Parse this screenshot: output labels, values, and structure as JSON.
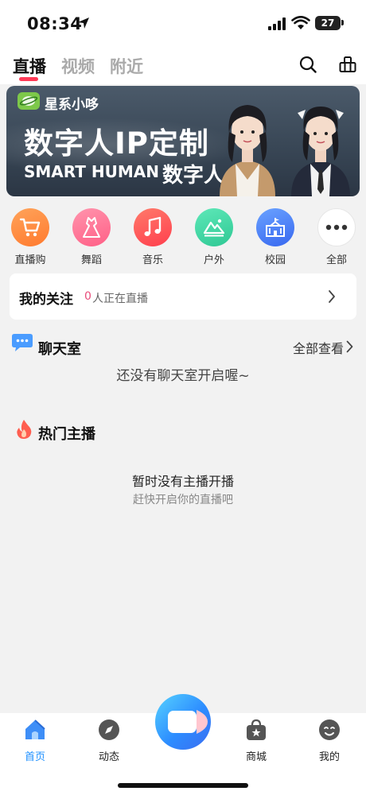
{
  "status_bar": {
    "time": "08:34",
    "battery": "27"
  },
  "top_tabs": [
    {
      "label": "直播",
      "active": true
    },
    {
      "label": "视频",
      "active": false
    },
    {
      "label": "附近",
      "active": false
    }
  ],
  "banner": {
    "brand": "星系小哆",
    "title": "数字人IP定制",
    "subtitle_en": "SMART HUMAN",
    "subtitle_cn": "数字人"
  },
  "categories": [
    {
      "label": "直播购",
      "icon": "shopping-cart-icon",
      "color": "#ff8c3a"
    },
    {
      "label": "舞蹈",
      "icon": "dress-icon",
      "color": "#ff6f8e"
    },
    {
      "label": "音乐",
      "icon": "music-note-icon",
      "color": "#ff4f55"
    },
    {
      "label": "户外",
      "icon": "mountain-icon",
      "color": "#3fd7a0"
    },
    {
      "label": "校园",
      "icon": "school-icon",
      "color": "#3b7cf5"
    },
    {
      "label": "全部",
      "icon": "more-dots-icon",
      "color": "#ffffff"
    }
  ],
  "follow": {
    "title": "我的关注",
    "count": "0",
    "text": "人正在直播"
  },
  "chatroom": {
    "title": "聊天室",
    "see_all": "全部查看",
    "empty": "还没有聊天室开启喔~"
  },
  "hot": {
    "title": "热门主播",
    "empty_title": "暂时没有主播开播",
    "empty_sub": "赶快开启你的直播吧"
  },
  "tabbar": [
    {
      "label": "首页",
      "icon": "home-icon",
      "active": true
    },
    {
      "label": "动态",
      "icon": "compass-icon",
      "active": false
    },
    {
      "label": "商城",
      "icon": "shop-bag-icon",
      "active": false
    },
    {
      "label": "我的",
      "icon": "profile-icon",
      "active": false
    }
  ],
  "colors": {
    "accent": "#ff3a57",
    "active_tab": "#1e90ff",
    "background": "#f2f2f2"
  }
}
